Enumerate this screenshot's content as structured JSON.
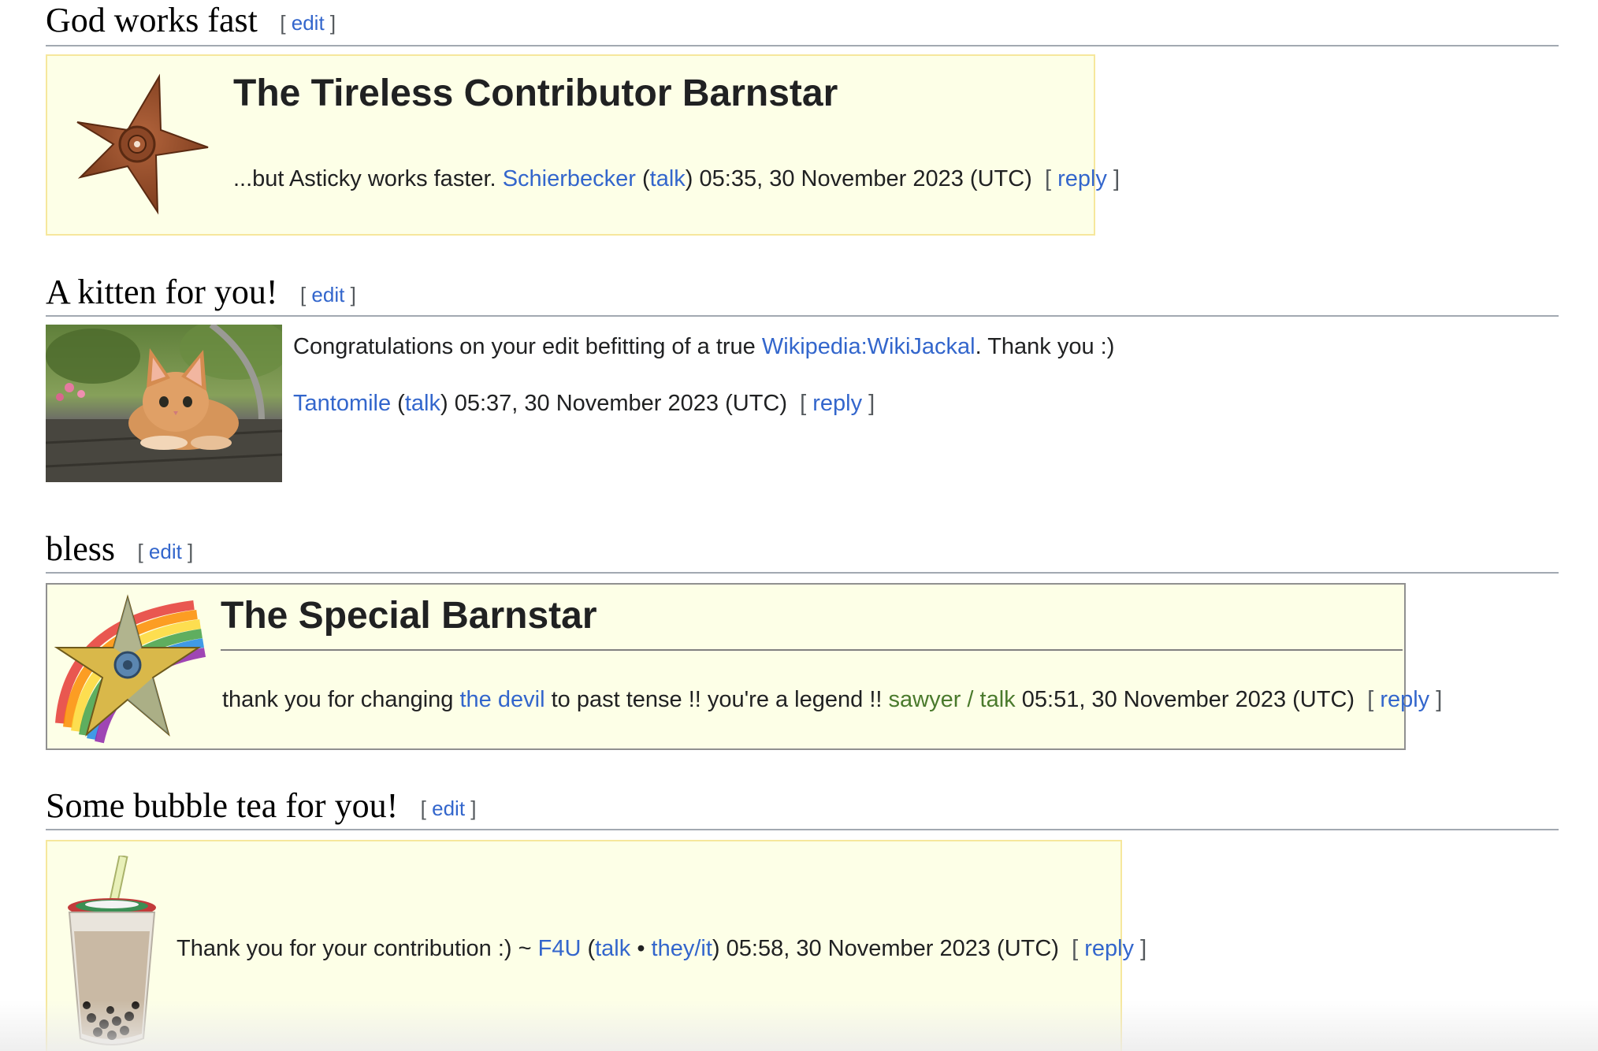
{
  "sections": [
    {
      "heading": "God works fast",
      "edit_label": "edit",
      "barnstar_title": "The Tireless Contributor Barnstar",
      "message": "...but Asticky works faster.",
      "user": "Schierbecker",
      "talk": "talk",
      "timestamp": ") 05:35, 30 November 2023 (UTC)",
      "reply": "reply"
    },
    {
      "heading": "A kitten for you!",
      "edit_label": "edit",
      "message_before": "Congratulations on your edit befitting of a true",
      "message_link": "Wikipedia:WikiJackal",
      "message_after": ". Thank you :)",
      "user": "Tantomile",
      "talk": "talk",
      "timestamp": ") 05:37, 30 November 2023 (UTC)",
      "reply": "reply"
    },
    {
      "heading": "bless",
      "edit_label": "edit",
      "barnstar_title": "The Special Barnstar",
      "message_before": "thank you for changing",
      "message_link": "the devil",
      "message_after": "to past tense !! you're a legend !!",
      "user": "sawyer / talk",
      "timestamp": "05:51, 30 November 2023 (UTC)",
      "reply": "reply"
    },
    {
      "heading": "Some bubble tea for you!",
      "edit_label": "edit",
      "message": "Thank you for your contribution :) ~",
      "user": "F4U",
      "talk": "talk",
      "pronouns": "they/it",
      "timestamp": ") 05:58, 30 November 2023 (UTC)",
      "reply": "reply"
    }
  ],
  "colors": {
    "link": "#3366cc",
    "signature_green": "#4a7a2c",
    "barnstar_bg": "#fdffe7",
    "barnstar_border": "#f6e79c"
  }
}
